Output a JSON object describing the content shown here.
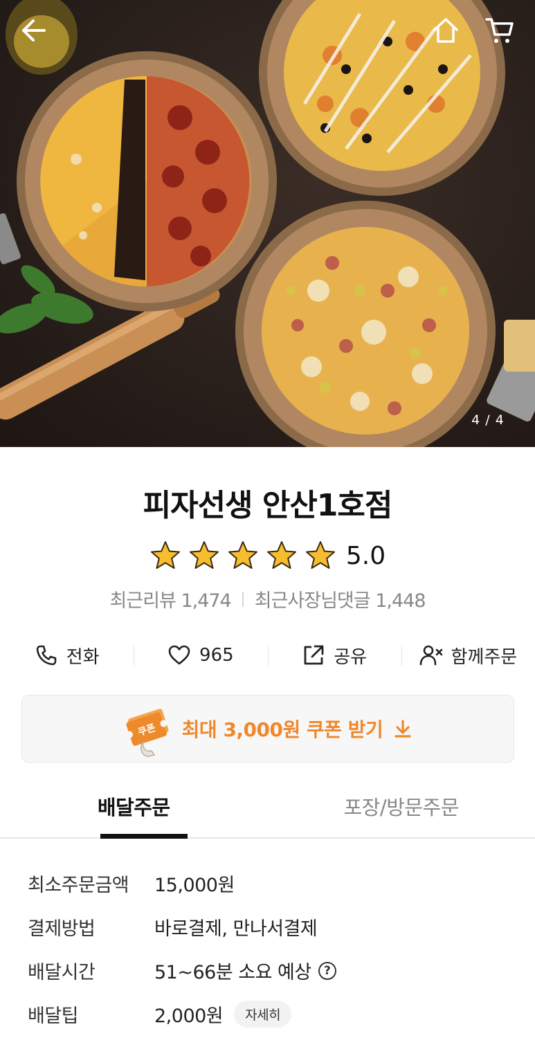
{
  "hero": {
    "counter": "4 / 4",
    "icons": {
      "back": "back-arrow-icon",
      "home": "home-icon",
      "cart": "cart-icon"
    }
  },
  "store": {
    "name": "피자선생 안산1호점",
    "rating": "5.0",
    "stars": 5,
    "recent_reviews_label": "최근리뷰",
    "recent_reviews_count": "1,474",
    "owner_replies_label": "최근사장님댓글",
    "owner_replies_count": "1,448"
  },
  "actions": {
    "call": "전화",
    "like": "965",
    "share": "공유",
    "group_order": "함께주문"
  },
  "coupon": {
    "ticket_text": "쿠폰",
    "text": "최대 3,000원 쿠폰 받기",
    "accent_color": "#f0872a"
  },
  "tabs": {
    "delivery": "배달주문",
    "pickup": "포장/방문주문",
    "active": "delivery"
  },
  "info": [
    {
      "label": "최소주문금액",
      "value": "15,000원"
    },
    {
      "label": "결제방법",
      "value": "바로결제, 만나서결제"
    },
    {
      "label": "배달시간",
      "value": "51~66분 소요 예상",
      "help": "?"
    },
    {
      "label": "배달팁",
      "value": "2,000원",
      "button": "자세히"
    }
  ]
}
